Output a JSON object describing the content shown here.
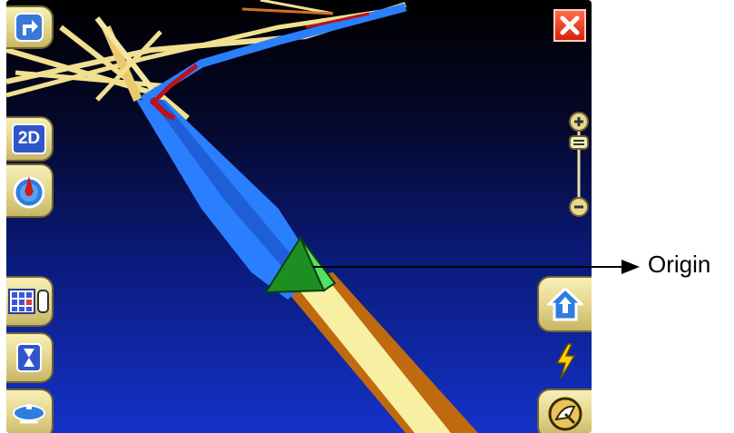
{
  "callout": {
    "label": "Origin"
  },
  "buttons": {
    "turn": {
      "icon": "turn-right-icon"
    },
    "view_mode": {
      "label": "2D"
    },
    "compass": {
      "icon": "compass-icon"
    },
    "menu": {
      "icon": "grid-vehicle-icon"
    },
    "hourglass": {
      "icon": "hourglass-icon"
    },
    "satellite_dish": {
      "icon": "satellite-dish-icon"
    },
    "home": {
      "icon": "home-icon"
    },
    "power": {
      "icon": "lightning-icon"
    },
    "gps": {
      "icon": "gps-satellite-icon"
    },
    "close": {
      "icon": "close-icon"
    },
    "zoom_in": {
      "icon": "plus-icon"
    },
    "zoom_out": {
      "icon": "minus-icon"
    }
  },
  "colors": {
    "sky_top": "#000000",
    "sky_bottom": "#1432c8",
    "road_fill": "#f7f0a3",
    "road_edge": "#c06a10",
    "route": "#2288ff",
    "position_marker": "#2fcc3a"
  }
}
